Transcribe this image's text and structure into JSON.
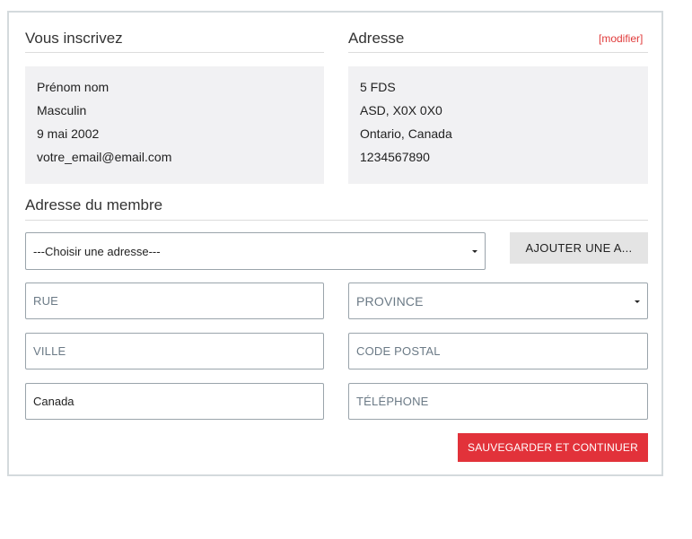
{
  "registration": {
    "title": "Vous inscrivez",
    "lines": [
      "Prénom nom",
      "Masculin",
      "9 mai 2002",
      "votre_email@email.com"
    ]
  },
  "address": {
    "title": "Adresse",
    "modify_label": "[modifier]",
    "lines": [
      "5 FDS",
      "ASD, X0X 0X0",
      "Ontario, Canada",
      "1234567890"
    ]
  },
  "member_address": {
    "title": "Adresse du membre",
    "select_value": "---Choisir une adresse---",
    "add_button": "AJOUTER UNE A...",
    "street_placeholder": "RUE",
    "province_value": "PROVINCE",
    "city_placeholder": "VILLE",
    "postal_placeholder": "CODE POSTAL",
    "country_value": "Canada",
    "phone_placeholder": "TÉLÉPHONE",
    "submit_label": "SAUVEGARDER ET CONTINUER"
  },
  "colors": {
    "accent": "#e2323a",
    "box_bg": "#f1f1f3",
    "border": "#d4dadd"
  }
}
